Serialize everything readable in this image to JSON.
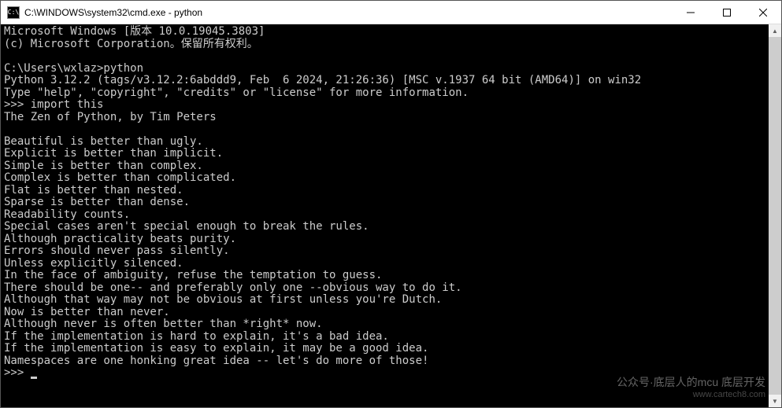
{
  "window": {
    "icon_text": "C:\\",
    "title": "C:\\WINDOWS\\system32\\cmd.exe - python"
  },
  "terminal": {
    "lines": [
      "Microsoft Windows [版本 10.0.19045.3803]",
      "(c) Microsoft Corporation。保留所有权利。",
      "",
      "C:\\Users\\wxlaz>python",
      "Python 3.12.2 (tags/v3.12.2:6abddd9, Feb  6 2024, 21:26:36) [MSC v.1937 64 bit (AMD64)] on win32",
      "Type \"help\", \"copyright\", \"credits\" or \"license\" for more information.",
      ">>> import this",
      "The Zen of Python, by Tim Peters",
      "",
      "Beautiful is better than ugly.",
      "Explicit is better than implicit.",
      "Simple is better than complex.",
      "Complex is better than complicated.",
      "Flat is better than nested.",
      "Sparse is better than dense.",
      "Readability counts.",
      "Special cases aren't special enough to break the rules.",
      "Although practicality beats purity.",
      "Errors should never pass silently.",
      "Unless explicitly silenced.",
      "In the face of ambiguity, refuse the temptation to guess.",
      "There should be one-- and preferably only one --obvious way to do it.",
      "Although that way may not be obvious at first unless you're Dutch.",
      "Now is better than never.",
      "Although never is often better than *right* now.",
      "If the implementation is hard to explain, it's a bad idea.",
      "If the implementation is easy to explain, it may be a good idea.",
      "Namespaces are one honking great idea -- let's do more of those!"
    ],
    "prompt": ">>> "
  },
  "watermark": {
    "main": "公众号·底层人的mcu 底层开发",
    "sub": "www.cartech8.com"
  }
}
